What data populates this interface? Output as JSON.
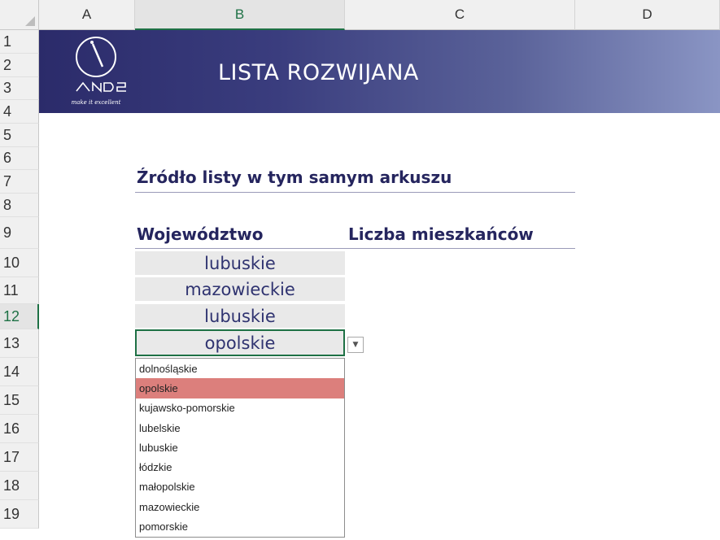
{
  "columns": [
    "A",
    "B",
    "C",
    "D"
  ],
  "rows": [
    "1",
    "2",
    "3",
    "4",
    "5",
    "6",
    "7",
    "8",
    "9",
    "10",
    "11",
    "12",
    "13",
    "14",
    "15",
    "16",
    "17",
    "18",
    "19"
  ],
  "banner": {
    "title": "LISTA ROZWIJANA",
    "logo_text": "AND2",
    "logo_tagline": "make it excellent"
  },
  "section_heading": "Źródło listy w tym samym arkuszu",
  "table": {
    "header_col1": "Województwo",
    "header_col2": "Liczba mieszkańców",
    "cells": [
      "lubuskie",
      "mazowieckie",
      "lubuskie",
      "opolskie"
    ]
  },
  "dropdown": {
    "selected": "opolskie",
    "items": [
      "dolnośląskie",
      "opolskie",
      "kujawsko-pomorskie",
      "lubelskie",
      "lubuskie",
      "łódzkie",
      "małopolskie",
      "mazowieckie",
      "pomorskie"
    ]
  },
  "colors": {
    "banner_start": "#2b2b6a",
    "banner_end": "#8a95c4",
    "heading_text": "#25255e",
    "highlight": "#dc7f7c",
    "selection_border": "#1e7145"
  }
}
